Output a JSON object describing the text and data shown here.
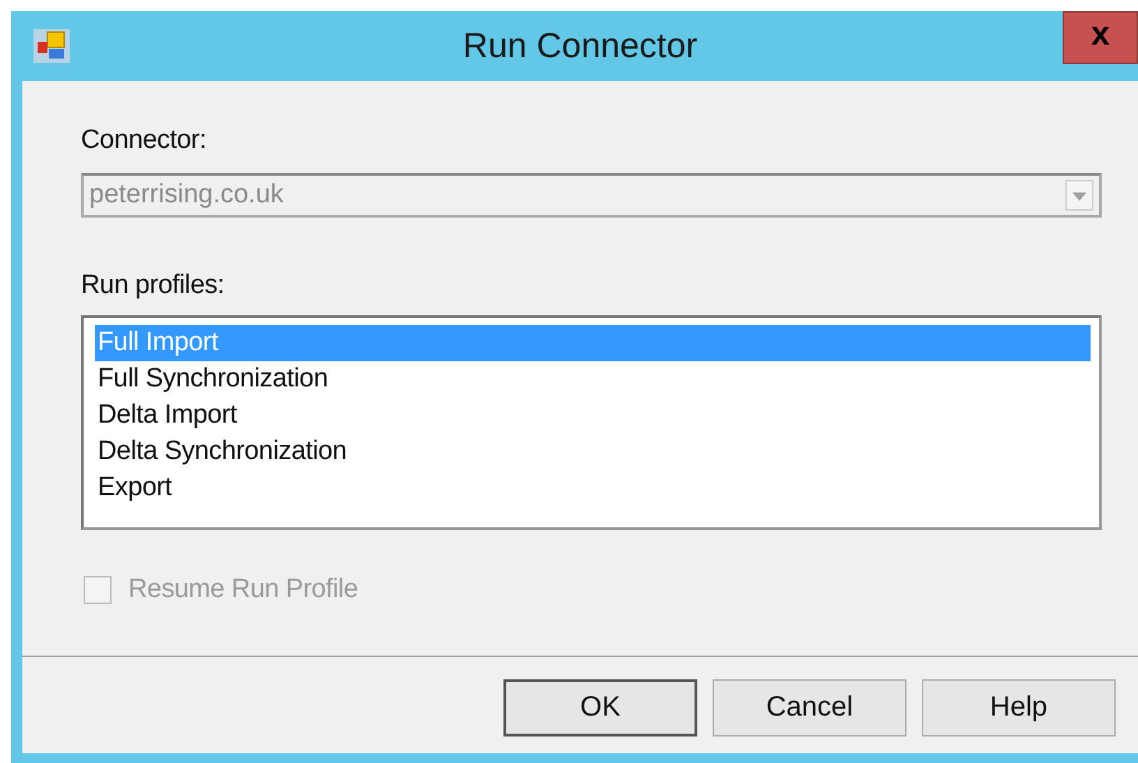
{
  "window": {
    "title": "Run Connector",
    "close": "x"
  },
  "connector": {
    "label": "Connector:",
    "value": "peterrising.co.uk",
    "disabled": true
  },
  "run_profiles": {
    "label": "Run profiles:",
    "items": [
      {
        "label": "Full Import",
        "selected": true
      },
      {
        "label": "Full Synchronization",
        "selected": false
      },
      {
        "label": "Delta Import",
        "selected": false
      },
      {
        "label": "Delta Synchronization",
        "selected": false
      },
      {
        "label": "Export",
        "selected": false
      }
    ]
  },
  "resume": {
    "label": "Resume Run Profile",
    "checked": false,
    "disabled": true
  },
  "buttons": [
    {
      "label": "OK",
      "default": true
    },
    {
      "label": "Cancel",
      "default": false
    },
    {
      "label": "Help",
      "default": false
    }
  ]
}
